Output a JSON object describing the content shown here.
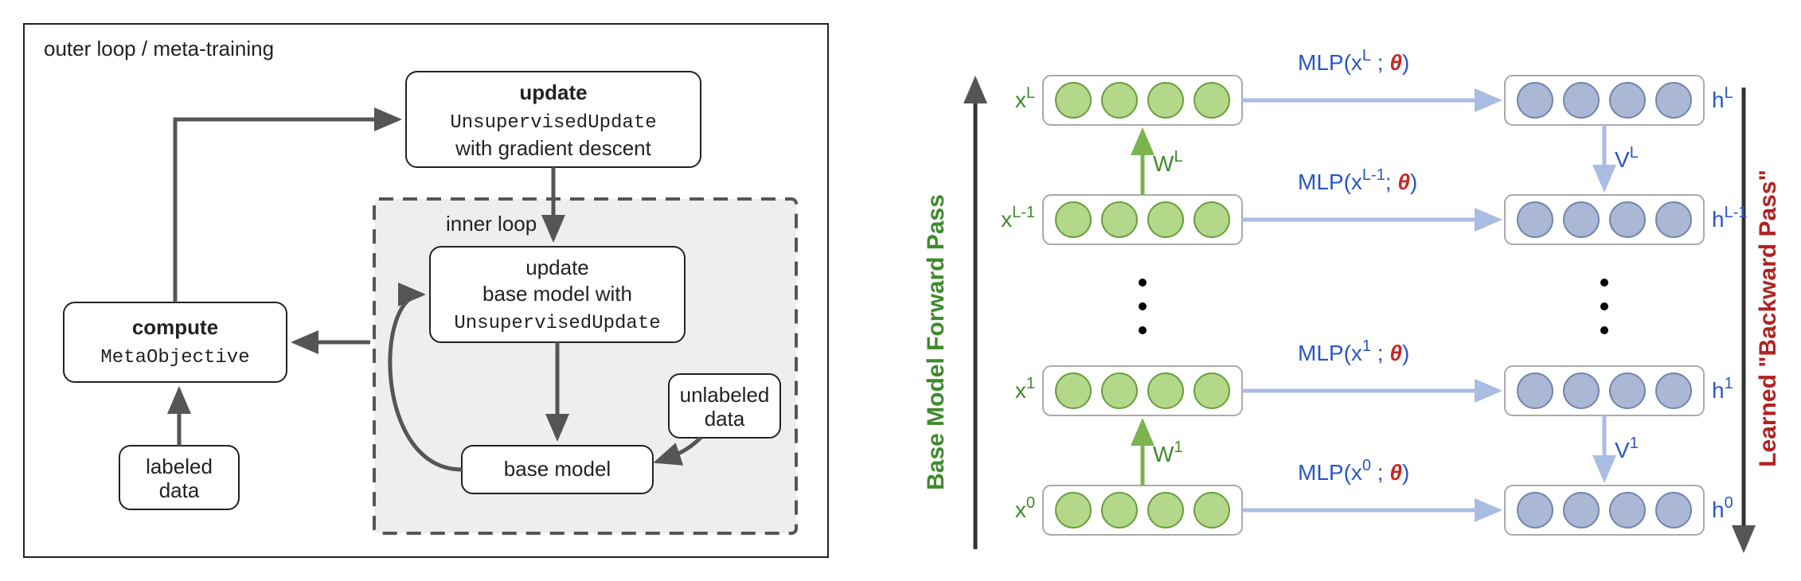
{
  "left": {
    "title": "outer loop / meta-training",
    "update_outer_l1": "update",
    "update_outer_l2": "UnsupervisedUpdate",
    "update_outer_l3": "with gradient descent",
    "inner_title": "inner loop",
    "update_inner_l1": "update",
    "update_inner_l2": "base model with",
    "update_inner_l3": "UnsupervisedUpdate",
    "base_model": "base model",
    "unlabeled_l1": "unlabeled",
    "unlabeled_l2": "data",
    "compute_l1": "compute",
    "compute_l2": "MetaObjective",
    "labeled_l1": "labeled",
    "labeled_l2": "data"
  },
  "right": {
    "forward_title": "Base Model Forward Pass",
    "backward_title": "Learned \"Backward Pass\"",
    "x_labels": [
      "x",
      "x",
      "x",
      "x"
    ],
    "x_sup": [
      "L",
      "L-1",
      "1",
      "0"
    ],
    "h_labels": [
      "h",
      "h",
      "h",
      "h"
    ],
    "h_sup": [
      "L",
      "L-1",
      "1",
      "0"
    ],
    "W_top": "W",
    "W_top_sup": "L",
    "W_bot": "W",
    "W_bot_sup": "1",
    "V_top": "V",
    "V_top_sup": "L",
    "V_bot": "V",
    "V_bot_sup": "1",
    "mlp0_a": "MLP(x",
    "mlp0_s": "L",
    "mlp0_b": " ; ",
    "mlp0_t": "θ",
    "mlp0_c": ")",
    "mlp1_a": "MLP(x",
    "mlp1_s": "L-1",
    "mlp1_b": "; ",
    "mlp1_t": "θ",
    "mlp1_c": ")",
    "mlp2_a": "MLP(x",
    "mlp2_s": "1",
    "mlp2_b": " ; ",
    "mlp2_t": "θ",
    "mlp2_c": ")",
    "mlp3_a": "MLP(x",
    "mlp3_s": "0",
    "mlp3_b": " ; ",
    "mlp3_t": "θ",
    "mlp3_c": ")"
  }
}
